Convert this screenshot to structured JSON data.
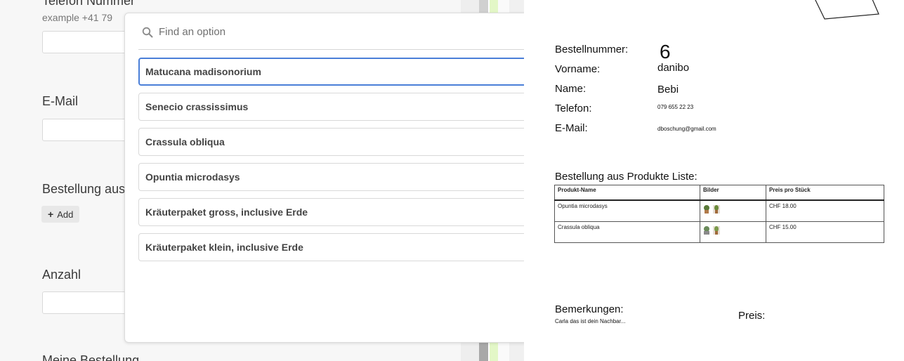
{
  "form": {
    "phone_label": "Telefon Nummer",
    "phone_hint": "example +41 79",
    "email_label": "E-Mail",
    "order_label": "Bestellung aus",
    "add_button": "Add",
    "quantity_label": "Anzahl",
    "my_order_label": "Meine Bestellung"
  },
  "popup": {
    "search_placeholder": "Find an option",
    "search_value": "",
    "options": [
      {
        "label": "Matucana madisonorium",
        "highlighted": true
      },
      {
        "label": "Senecio crassissimus",
        "highlighted": false
      },
      {
        "label": "Crassula obliqua",
        "highlighted": false
      },
      {
        "label": "Opuntia microdasys",
        "highlighted": false
      },
      {
        "label": "Kräuterpaket gross, inclusive Erde",
        "highlighted": false
      },
      {
        "label": "Kräuterpaket klein, inclusive Erde",
        "highlighted": false
      }
    ],
    "icons": {
      "search": "search-icon",
      "close": "close-icon"
    },
    "highlight_color": "#4a7fd8"
  },
  "document": {
    "order_number_label": "Bestellnummer:",
    "order_number_value": "6",
    "firstname_label": "Vorname:",
    "firstname_value": "danibo",
    "name_label": "Name:",
    "name_value": "Bebi",
    "phone_label": "Telefon:",
    "phone_value": "079 655 22 23",
    "email_label": "E-Mail:",
    "email_value": "dboschung@gmail.com",
    "products_heading": "Bestellung aus Produkte Liste:",
    "table": {
      "headers": [
        "Produkt-Name",
        "Bilder",
        "Preis pro Stück"
      ],
      "rows": [
        {
          "name": "Opuntia microdasys",
          "price": "CHF 18.00"
        },
        {
          "name": "Crassula obliqua",
          "price": "CHF 15.00"
        }
      ]
    },
    "remarks_label": "Bemerkungen:",
    "remarks_value": "Carla das ist dein Nachbar...",
    "price_label": "Preis:"
  },
  "colors": {
    "accent_green": "#e3f7c7",
    "form_background": "#f7f7f7"
  }
}
